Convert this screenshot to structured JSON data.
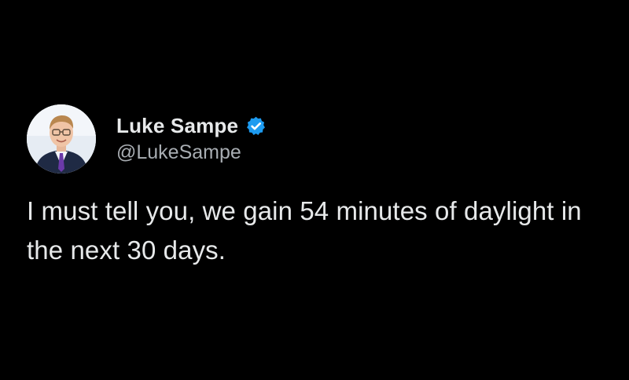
{
  "tweet": {
    "author": {
      "display_name": "Luke Sampe",
      "handle": "@LukeSampe",
      "verified": true,
      "avatar_icon": "profile-photo",
      "badge_icon": "verified-badge-icon",
      "badge_color": "#1d9bf0"
    },
    "text": "I must tell you, we gain 54 minutes of daylight in the next 30 days."
  },
  "colors": {
    "background": "#000000",
    "primary_text": "#e7e9ea",
    "secondary_text": "#a8adb2"
  }
}
